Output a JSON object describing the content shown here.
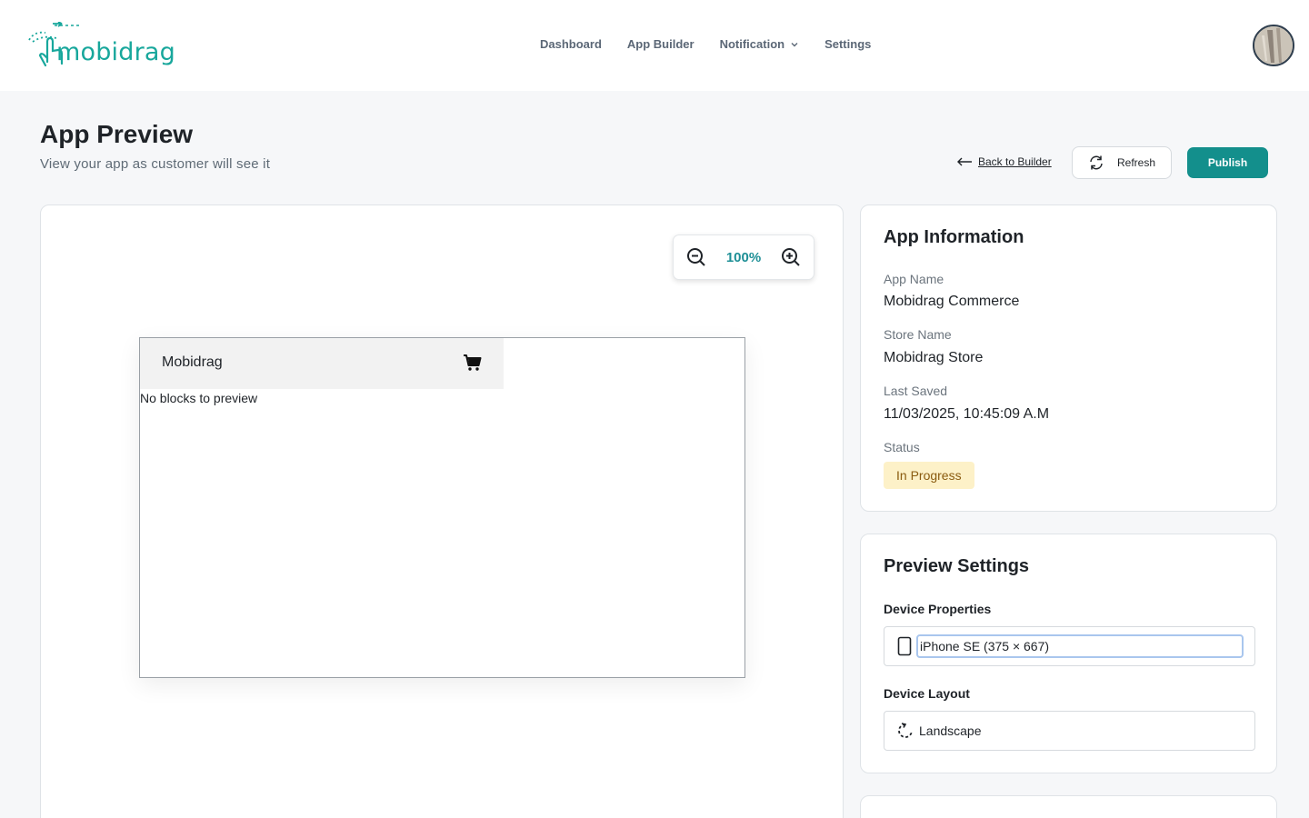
{
  "brand": {
    "name": "mobidrag",
    "color": "#18a79c"
  },
  "nav": {
    "items": [
      {
        "label": "Dashboard"
      },
      {
        "label": "App Builder"
      },
      {
        "label": "Notification",
        "has_dropdown": true
      },
      {
        "label": "Settings"
      }
    ]
  },
  "page": {
    "title": "App Preview",
    "subtitle": "View your app as customer will see it"
  },
  "actions": {
    "back_label": "Back to Builder",
    "refresh_label": "Refresh",
    "publish_label": "Publish",
    "publish_color": "#138f8c"
  },
  "preview": {
    "zoom": "100%",
    "app_title": "Mobidrag",
    "empty_message": "No blocks to preview"
  },
  "app_info": {
    "title": "App Information",
    "fields": [
      {
        "label": "App Name",
        "value": "Mobidrag Commerce"
      },
      {
        "label": "Store Name",
        "value": "Mobidrag Store"
      },
      {
        "label": "Last Saved",
        "value": "11/03/2025, 10:45:09 A.M"
      }
    ],
    "status_label": "Status",
    "status_value": "In Progress",
    "status_color": "#fdf1c8"
  },
  "preview_settings": {
    "title": "Preview Settings",
    "device_properties_label": "Device Properties",
    "device_value": "iPhone SE (375 × 667)",
    "device_layout_label": "Device Layout",
    "layout_value": "Landscape"
  }
}
